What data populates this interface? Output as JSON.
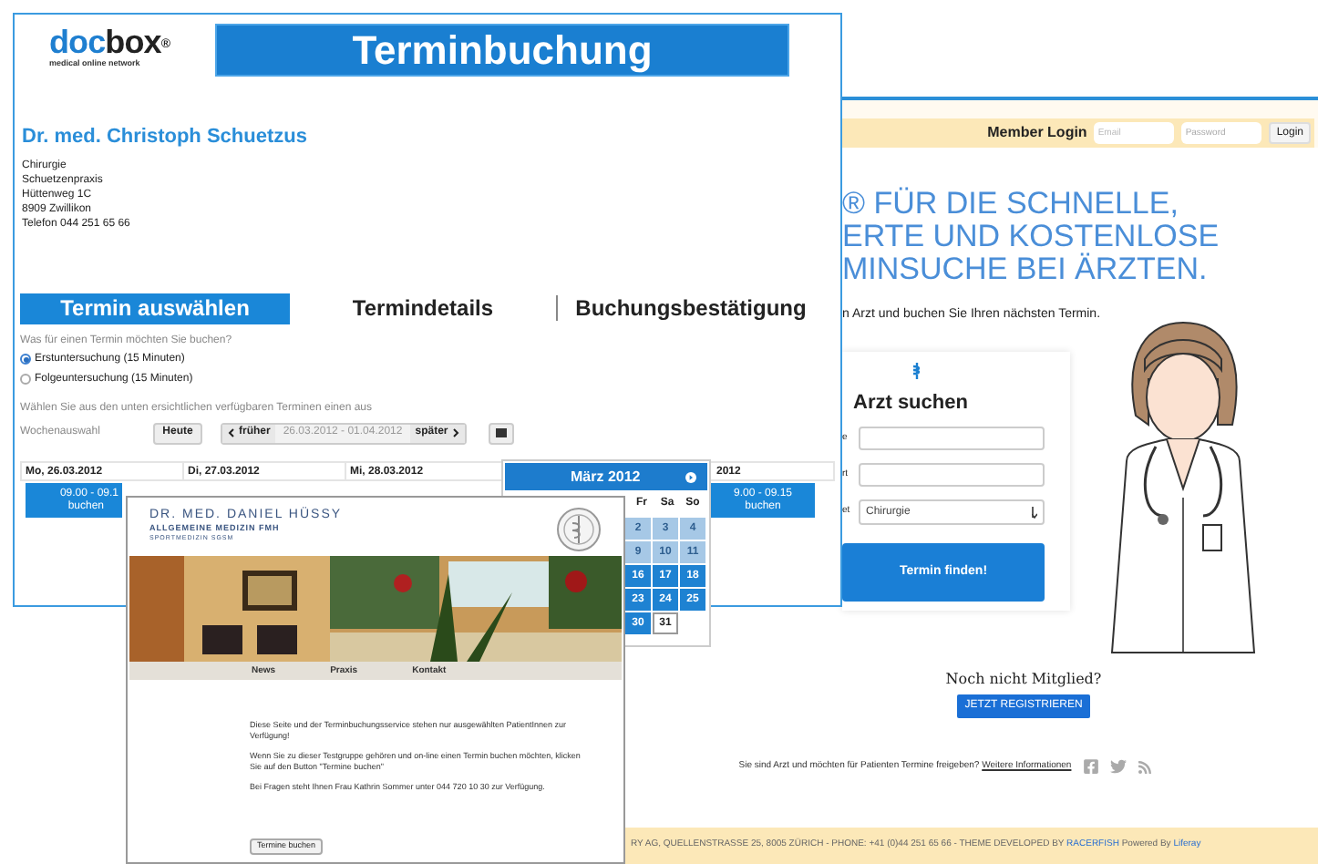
{
  "booking_window": {
    "logo": {
      "part_1": "doc",
      "part_2": "box",
      "mark": "®",
      "tagline": "medical online network"
    },
    "banner": "Terminbuchung",
    "doctor_name": "Dr. med. Christoph Schuetzus",
    "address": [
      "Chirurgie",
      "Schuetzenpraxis",
      "Hüttenweg 1C",
      "8909 Zwillikon",
      "Telefon 044 251 65 66"
    ],
    "tabs": [
      {
        "label": "Termin auswählen",
        "selected": true
      },
      {
        "label": "Termindetails",
        "selected": false
      },
      {
        "label": "Buchungsbestätigung",
        "selected": false
      }
    ],
    "question": "Was für einen Termin möchten Sie buchen?",
    "options": [
      {
        "label": "Erstuntersuchung (15 Minuten)",
        "selected": true
      },
      {
        "label": "Folgeuntersuchung (15 Minuten)",
        "selected": false
      }
    ],
    "instruction": "Wählen Sie aus den unten ersichtlichen verfügbaren Terminen einen aus",
    "week_label": "Wochenauswahl",
    "today_button": "Heute",
    "prev_button": "früher",
    "date_range": "26.03.2012 - 01.04.2012",
    "next_button": "später",
    "days": [
      {
        "header": "Mo, 26.03.2012",
        "slot": {
          "time": "09.00 - 09.1",
          "action": "buchen"
        }
      },
      {
        "header": "Di, 27.03.2012"
      },
      {
        "header": "Mi, 28.03.2012"
      }
    ],
    "last_day": {
      "header": "2012",
      "slot": {
        "time": "9.00 - 09.15",
        "action": "buchen"
      }
    },
    "calendar": {
      "title": "März 2012",
      "weekdays": [
        "Fr",
        "Sa",
        "So"
      ],
      "weeks": [
        [
          {
            "day": "2",
            "disabled": true,
            "selected": false
          },
          {
            "day": "3",
            "disabled": true,
            "selected": false
          },
          {
            "day": "4",
            "disabled": true,
            "selected": false
          }
        ],
        [
          {
            "day": "9",
            "disabled": true,
            "selected": false
          },
          {
            "day": "10",
            "disabled": true,
            "selected": false
          },
          {
            "day": "11",
            "disabled": true,
            "selected": false
          }
        ],
        [
          {
            "day": "16",
            "disabled": false,
            "selected": false
          },
          {
            "day": "17",
            "disabled": false,
            "selected": false
          },
          {
            "day": "18",
            "disabled": false,
            "selected": false
          }
        ],
        [
          {
            "day": "23",
            "disabled": false,
            "selected": false
          },
          {
            "day": "24",
            "disabled": false,
            "selected": false
          },
          {
            "day": "25",
            "disabled": false,
            "selected": false
          }
        ],
        [
          {
            "day": "30",
            "disabled": false,
            "selected": false
          },
          {
            "day": "31",
            "disabled": false,
            "selected": true
          }
        ]
      ]
    }
  },
  "practice_window": {
    "name": "DR. MED. DANIEL HÜSSY",
    "specialty": "ALLGEMEINE MEDIZIN FMH",
    "subspecialty": "SPORTMEDIZIN SGSM",
    "nav": [
      "News",
      "Praxis",
      "Kontakt"
    ],
    "paragraphs": [
      "Diese Seite und der Terminbuchungsservice stehen nur ausgewählten PatientInnen zur Verfügung!",
      "Wenn Sie zu dieser Testgruppe gehören und on-line einen Termin buchen möchten, klicken Sie auf den Button \"Termine buchen\"",
      "Bei Fragen steht Ihnen Frau Kathrin Sommer unter 044 720 10 30 zur Verfügung."
    ],
    "button": "Termine buchen"
  },
  "search_window": {
    "member_login": "Member Login",
    "email_placeholder": "Email",
    "password_placeholder": "Password",
    "login_button": "Login",
    "headline": [
      "® FÜR DIE SCHNELLE,",
      "ERTE UND KOSTENLOSE",
      "MINSUCHE BEI ÄRZTEN."
    ],
    "subtitle": "n Arzt und buchen Sie Ihren nächsten Termin.",
    "search": {
      "title": "Arzt suchen",
      "fields": [
        {
          "label": "e",
          "kind": "text"
        },
        {
          "label": "rt",
          "kind": "text"
        },
        {
          "label": "et",
          "kind": "select",
          "value": "Chirurgie"
        }
      ],
      "button": "Termin finden!"
    },
    "signup_question": "Noch nicht Mitglied?",
    "signup_button": "JETZT REGISTRIEREN",
    "footer_text": "Sie sind Arzt und möchten für Patienten Termine freigeben?",
    "footer_link": "Weitere Informationen",
    "bottom_text": "RY AG, QUELLENSTRASSE 25, 8005 ZÜRICH - PHONE: +41 (0)44 251 65 66 - THEME DEVELOPED BY",
    "bottom_link_1": "RACERFISH",
    "bottom_text_2": "Powered By",
    "bottom_link_2": "Liferay"
  }
}
